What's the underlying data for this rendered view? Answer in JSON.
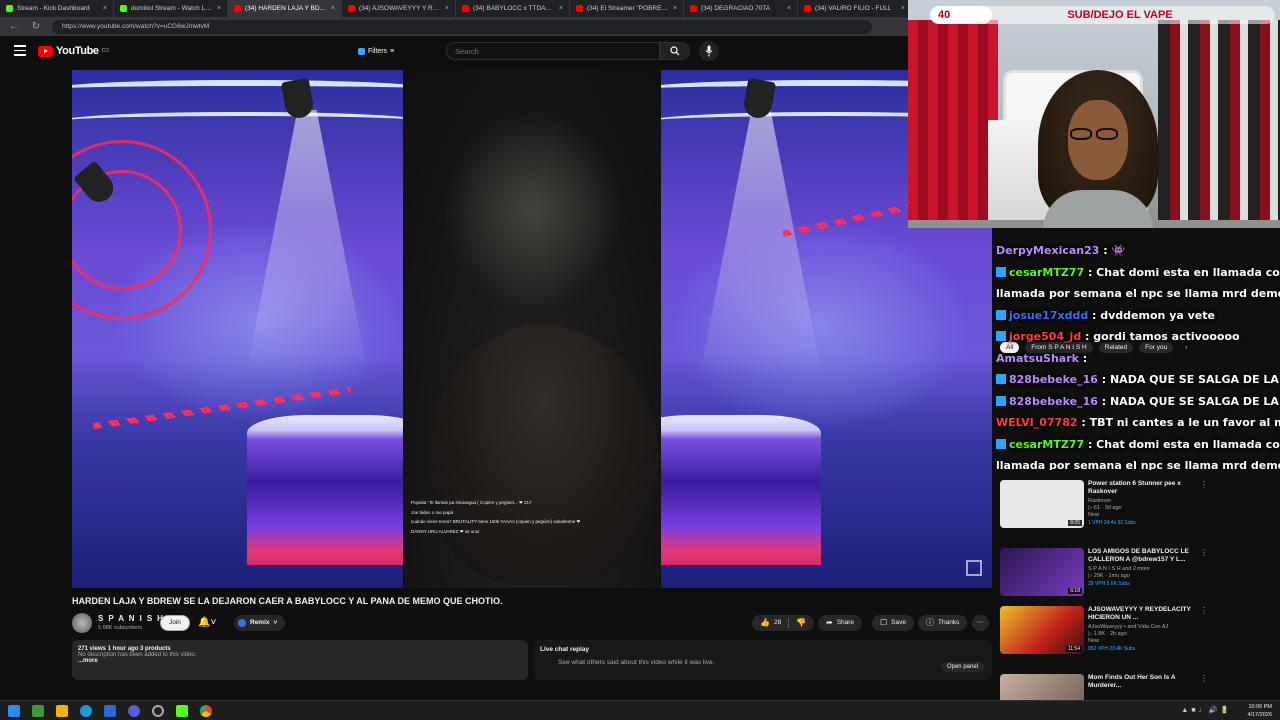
{
  "browser": {
    "tabs": [
      {
        "label": "Stream - Kick Dashboard",
        "color": "#53fc18",
        "active": false
      },
      {
        "label": "domiiiol Stream - Watch Live on",
        "color": "#53fc18",
        "active": false
      },
      {
        "label": "(34) HARDEN LAJA Y BDREW SE",
        "color": "#ff0000",
        "active": true
      },
      {
        "label": "(34) AJSOWAVEYYY Y REYDELA",
        "color": "#ff0000",
        "active": false
      },
      {
        "label": "(34) BABYLOCC x TTDAYBB - EL",
        "color": "#ff0000",
        "active": false
      },
      {
        "label": "(34) El Streamer \"POBRE\" Más R",
        "color": "#ff0000",
        "active": false
      },
      {
        "label": "(34) DEGRACIAO 70TA",
        "color": "#ff0000",
        "active": false
      },
      {
        "label": "(34) VALIRO FILIO - FULL",
        "color": "#ff0000",
        "active": false
      }
    ],
    "url": "https://www.youtube.com/watch?v=uCG6wJmwtvM"
  },
  "header": {
    "logo_text": "YouTube",
    "logo_sup": "CO",
    "filters_label": "Filters",
    "search_placeholder": "Search"
  },
  "stream_overlay": {
    "counter": "40",
    "goal_text": "SUB/DEJO EL VAPE",
    "goal_progress": 0.18
  },
  "chat": [
    {
      "user": "DerpyMexican23",
      "color": "#b98bff",
      "message": " : 👾",
      "badge": false
    },
    {
      "user": "cesarMTZ77",
      "color": "#53fc18",
      "message": " : Chat domi esta en llamada con la pr",
      "badge": true
    },
    {
      "user": "",
      "color": "#ffffff",
      "message": "llamada por semana el npc se llama mrd demon ⚔️ ⚔️",
      "badge": false
    },
    {
      "user": "josue17xddd",
      "color": "#3b6cff",
      "message": " : dvddemon ya vete",
      "badge": true
    },
    {
      "user": "jorge504_jd",
      "color": "#ff3b3b",
      "message": " : gordi tamos activooooo",
      "badge": true
    },
    {
      "user": "AmatsuShark",
      "color": "#b98bff",
      "message": " :",
      "badge": false
    },
    {
      "user": "828bebeke_16",
      "color": "#b98bff",
      "message": " : NADA QUE SE SALGA DE LA LLA",
      "badge": true
    },
    {
      "user": "828bebeke_16",
      "color": "#b98bff",
      "message": " : NADA QUE SE SALGA DE LA LLA",
      "badge": true
    },
    {
      "user": "WELVI_07782",
      "color": "#ff3b3b",
      "message": " : TBT ni cantes a le un favor al mundo",
      "badge": false
    },
    {
      "user": "cesarMTZ77",
      "color": "#53fc18",
      "message": " : Chat domi esta en llamada con la pr",
      "badge": true
    },
    {
      "user": "",
      "color": "#ffffff",
      "message": "llamada por semana el npc se llama mrd demon ⚔️ ⚔️",
      "badge": false
    }
  ],
  "filter_pills": [
    "All",
    "From S P A N I S H",
    "Related",
    "For you"
  ],
  "recommendations": [
    {
      "title": "Power station 6 Stunner pee x Raskover",
      "channel": "Raskover",
      "meta": "▷ 61 · 3d ago",
      "tag": "New",
      "stats": "1 VPH   24.4x   32 Subs",
      "duration": "8:05",
      "thumb": "#d9d9d9"
    },
    {
      "title": "LOS AMIGOS DE BABYLOCC LE CALLERON A @bdrew157 Y L...",
      "channel": "S P A N I S H and 2 more",
      "meta": "▷ 29K · 1mo ago",
      "tag": "",
      "stats": "28 VPH   5.6K Subs",
      "duration": "6:18",
      "thumb": "#4a2a78"
    },
    {
      "title": "AJSOWAVEYYY Y REYDELACITY HICIERON UN ...",
      "channel": "AJsoWaveyyy • and Vida Con AJ",
      "meta": "▷ 1.8K · 2h ago",
      "tag": "New",
      "stats": "952 VPH   23.4K Subs",
      "duration": "11:54",
      "thumb": "#b4201a"
    },
    {
      "title": "Mom Finds Out Her Son Is A Murderer...",
      "channel": "",
      "meta": "",
      "tag": "",
      "stats": "",
      "duration": "",
      "thumb": "#7a6a60"
    }
  ],
  "video": {
    "title": "HARDEN LAJA Y BDREW SE LA DEJARON CAER A BABYLOCC Y AL PANA DE MEMO QUE CHOTIO.",
    "channel_name": "S P A N I S H",
    "subscribers": "5.68K subscribers",
    "join_label": "Join",
    "remix_label": "Remix",
    "likes": "28",
    "share_label": "Share",
    "save_label": "Save",
    "thanks_label": "Thanks",
    "description_meta": "271 views  1 hour ago  3 products",
    "description_text": "No description has been added to this video.",
    "more_label": "...more",
    "replay_title": "Live chat replay",
    "replay_sub": "See what others said about this video while it was live.",
    "open_panel_label": "Open panel",
    "overlay_chat": [
      "Popular: Te llamas pa Nicaragua ( Copien y pegúen... ❤ 217",
      "Joe bideo o me papá",
      "cuando viene tema? BRUTALITY tiene 150k YAAAA (copien y pegúen) saludenme ❤",
      "DANNY URU ALVAREZ ❤ se unió"
    ]
  },
  "clock": {
    "time": "10:06 PM",
    "date": "4/17/2026"
  }
}
